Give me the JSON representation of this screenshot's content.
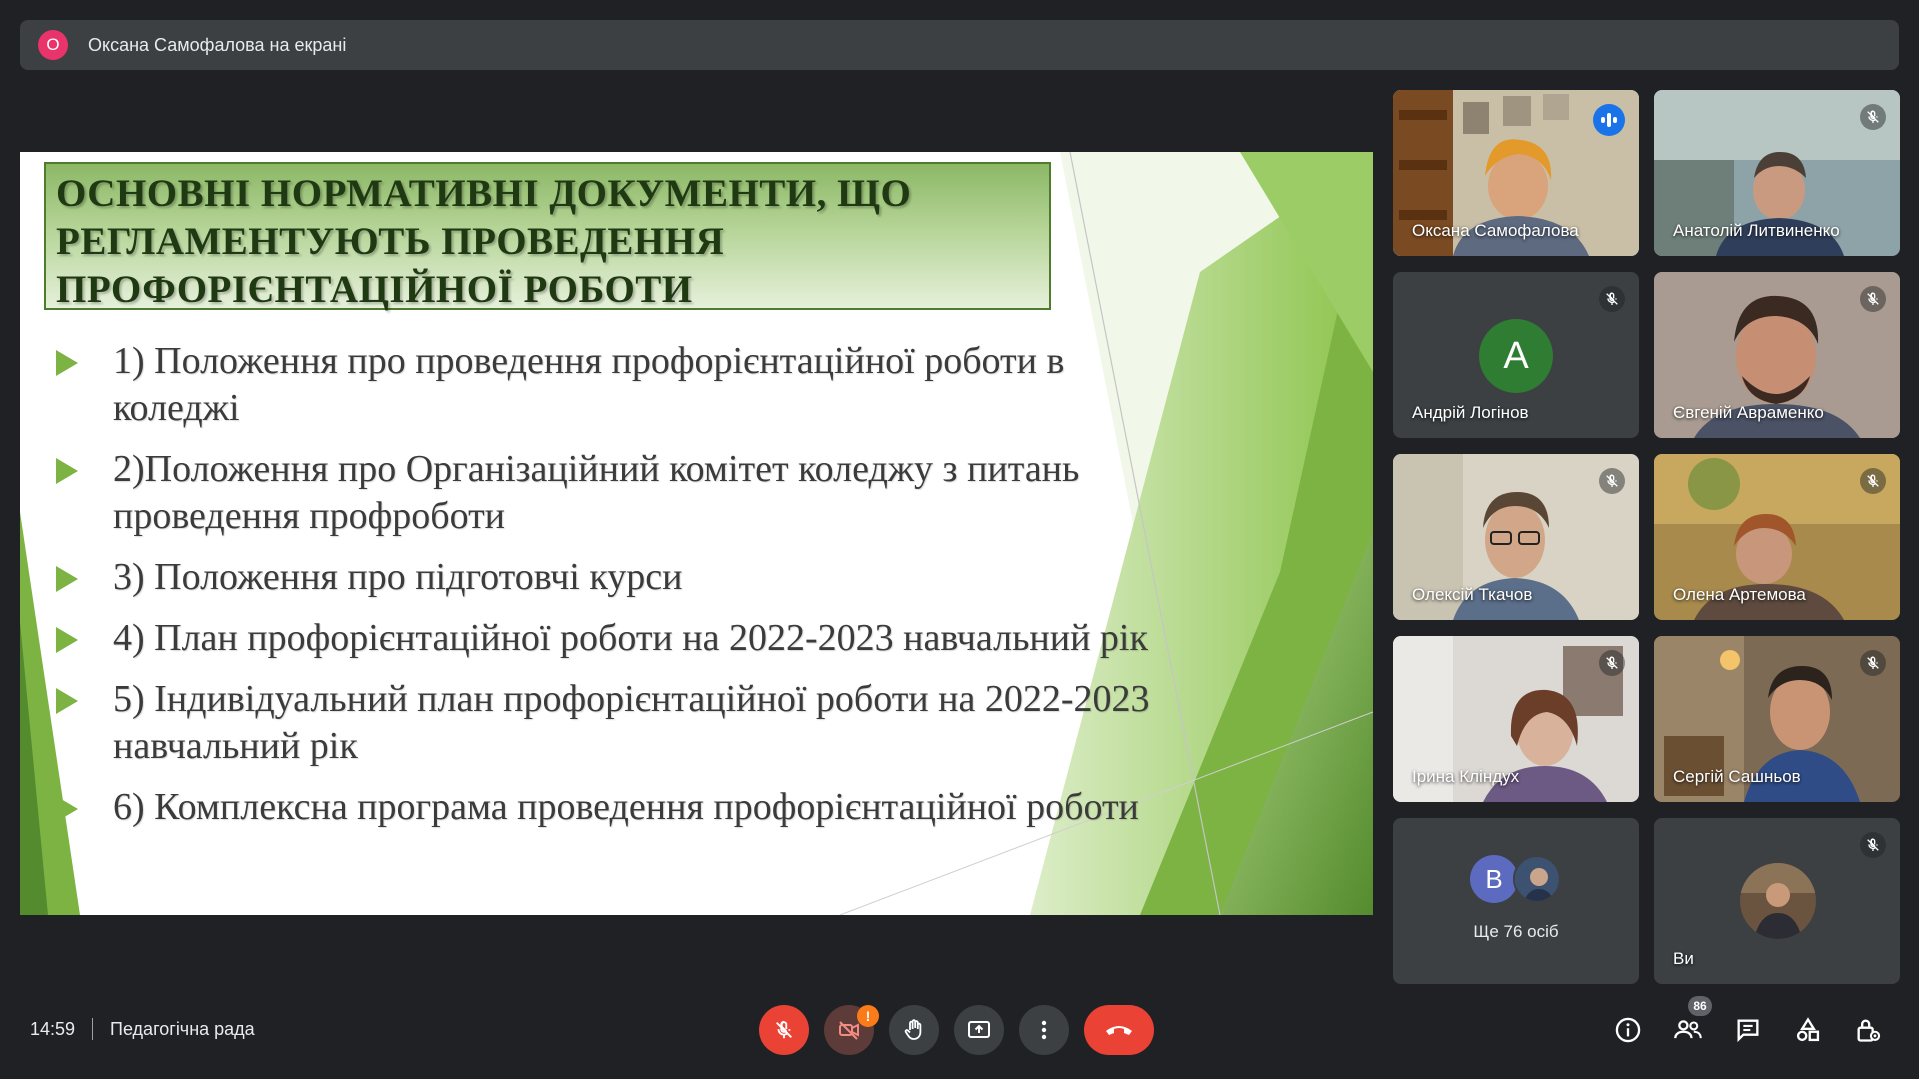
{
  "presenter_banner": {
    "avatar_letter": "О",
    "avatar_color": "#e8336b",
    "text": "Оксана Самофалова на екрані"
  },
  "slide": {
    "title_lines": [
      "ОСНОВНІ НОРМАТИВНІ ДОКУМЕНТИ, ЩО",
      "РЕГЛАМЕНТУЮТЬ ПРОВЕДЕННЯ",
      "ПРОФОРІЄНТАЦІЙНОЇ РОБОТИ"
    ],
    "bullets": [
      "1) Положення про проведення профорієнтаційної роботи в\nколеджі",
      "2)Положення про Організаційний комітет коледжу з питань\nпроведення профроботи",
      "3)  Положення про підготовчі курси",
      "4) План профорієнтаційної роботи на 2022-2023 навчальний рік",
      "5) Індивідуальний план профорієнтаційної роботи на  2022-2023\nнавчальний рік",
      "6) Комплексна програма проведення профорієнтаційної роботи"
    ],
    "accent_color": "#7cb342"
  },
  "participants": [
    {
      "name": "Оксана Самофалова",
      "state": "speaking",
      "icon": "audio-level-icon"
    },
    {
      "name": "Анатолій Литвиненко",
      "state": "muted",
      "icon": "mic-off-icon"
    },
    {
      "name": "Андрій Логінов",
      "state": "muted",
      "icon": "mic-off-icon",
      "avatar_letter": "А",
      "avatar_color": "#2e7d32"
    },
    {
      "name": "Євгеній Авраменко",
      "state": "muted",
      "icon": "mic-off-icon"
    },
    {
      "name": "Олексій Ткачов",
      "state": "muted",
      "icon": "mic-off-icon"
    },
    {
      "name": "Олена Артемова",
      "state": "muted",
      "icon": "mic-off-icon"
    },
    {
      "name": "Ірина Кліндух",
      "state": "muted",
      "icon": "mic-off-icon"
    },
    {
      "name": "Сергій Сашньов",
      "state": "muted",
      "icon": "mic-off-icon"
    }
  ],
  "others_tile": {
    "avatar_letter": "В",
    "label": "Ще 76 осіб"
  },
  "self_tile": {
    "name": "Ви",
    "state": "muted",
    "icon": "mic-off-icon"
  },
  "bottom_bar": {
    "time": "14:59",
    "meeting_title": "Педагогічна рада",
    "controls": [
      "mic-off-icon",
      "camera-off-icon",
      "raise-hand-icon",
      "present-screen-icon",
      "more-options-icon",
      "end-call-icon"
    ],
    "camera_warning": "!",
    "right_icons": [
      "info-icon",
      "people-icon",
      "chat-icon",
      "activities-icon",
      "host-controls-icon"
    ],
    "participant_count": "86"
  }
}
